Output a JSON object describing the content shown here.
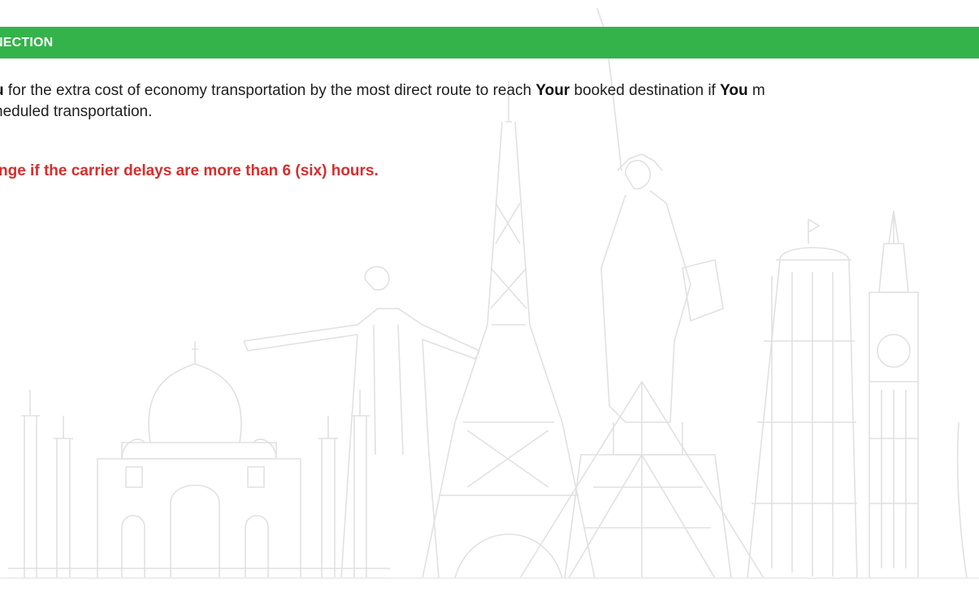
{
  "theme": {
    "accent_color": "#33b34a",
    "note_color": "#d32f2f",
    "text_color": "#202020"
  },
  "section": {
    "title": "NECTION"
  },
  "body": {
    "line1": {
      "seg1": "u",
      "seg2": " for the extra cost of economy transportation by the most direct route to reach ",
      "seg3": "Your",
      "seg4": " booked destination if ",
      "seg5": "You",
      "seg6": " m"
    },
    "line2": "heduled transportation."
  },
  "note": {
    "text": "nge if the carrier delays are more than 6 (six) hours."
  },
  "background": {
    "illustration": "world-landmarks-watermark"
  }
}
